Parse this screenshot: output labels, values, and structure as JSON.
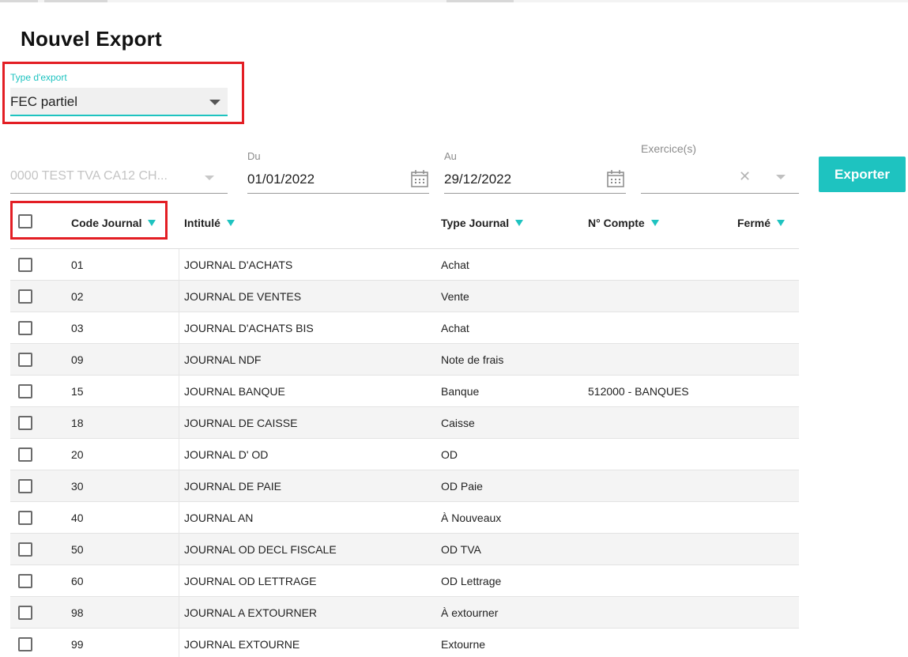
{
  "page_title": "Nouvel Export",
  "export_type": {
    "label": "Type d'export",
    "value": "FEC partiel"
  },
  "filters": {
    "dossier": {
      "placeholder": "0000 TEST TVA CA12 CH..."
    },
    "date_from": {
      "label": "Du",
      "value": "01/01/2022"
    },
    "date_to": {
      "label": "Au",
      "value": "29/12/2022"
    },
    "exercises": {
      "label": "Exercice(s)",
      "clear_icon": "✕"
    }
  },
  "export_button": {
    "label": "Exporter"
  },
  "colors": {
    "accent": "#1ec3c0",
    "highlight": "#e31e24"
  },
  "table": {
    "headers": {
      "code": "Code Journal",
      "intitule": "Intitulé",
      "type": "Type Journal",
      "compte": "N° Compte",
      "ferme": "Fermé"
    },
    "rows": [
      {
        "code": "01",
        "intitule": "JOURNAL D'ACHATS",
        "type": "Achat",
        "compte": "",
        "ferme": ""
      },
      {
        "code": "02",
        "intitule": "JOURNAL DE VENTES",
        "type": "Vente",
        "compte": "",
        "ferme": ""
      },
      {
        "code": "03",
        "intitule": "JOURNAL D'ACHATS BIS",
        "type": "Achat",
        "compte": "",
        "ferme": ""
      },
      {
        "code": "09",
        "intitule": "JOURNAL NDF",
        "type": "Note de frais",
        "compte": "",
        "ferme": ""
      },
      {
        "code": "15",
        "intitule": "JOURNAL BANQUE",
        "type": "Banque",
        "compte": "512000 - BANQUES",
        "ferme": ""
      },
      {
        "code": "18",
        "intitule": "JOURNAL DE CAISSE",
        "type": "Caisse",
        "compte": "",
        "ferme": ""
      },
      {
        "code": "20",
        "intitule": "JOURNAL D' OD",
        "type": "OD",
        "compte": "",
        "ferme": ""
      },
      {
        "code": "30",
        "intitule": "JOURNAL DE PAIE",
        "type": "OD Paie",
        "compte": "",
        "ferme": ""
      },
      {
        "code": "40",
        "intitule": "JOURNAL AN",
        "type": "À Nouveaux",
        "compte": "",
        "ferme": ""
      },
      {
        "code": "50",
        "intitule": "JOURNAL OD DECL FISCALE",
        "type": "OD TVA",
        "compte": "",
        "ferme": ""
      },
      {
        "code": "60",
        "intitule": "JOURNAL OD LETTRAGE",
        "type": "OD Lettrage",
        "compte": "",
        "ferme": ""
      },
      {
        "code": "98",
        "intitule": "JOURNAL A EXTOURNER",
        "type": "À extourner",
        "compte": "",
        "ferme": ""
      },
      {
        "code": "99",
        "intitule": "JOURNAL EXTOURNE",
        "type": "Extourne",
        "compte": "",
        "ferme": ""
      }
    ]
  }
}
